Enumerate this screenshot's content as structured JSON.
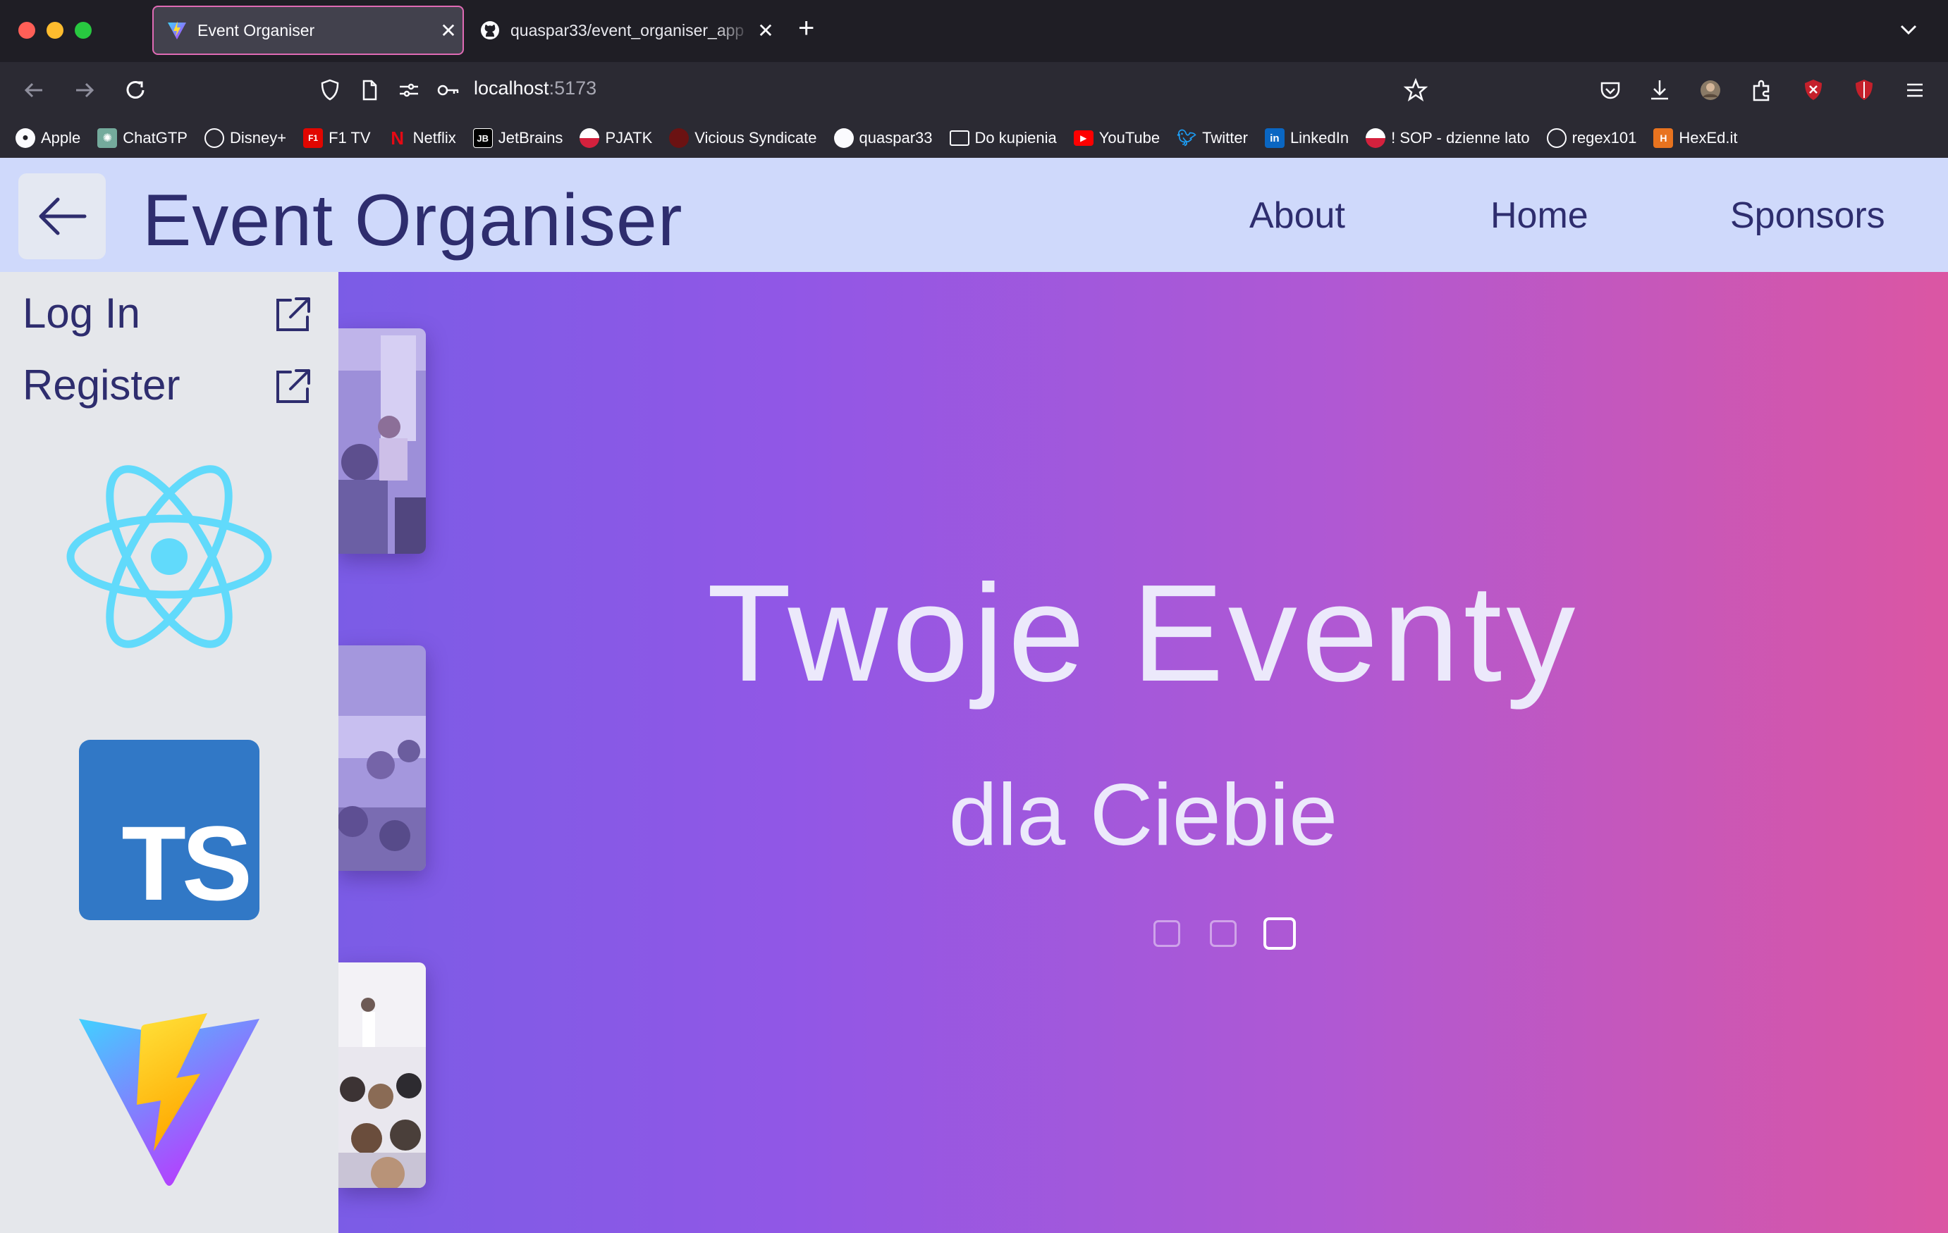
{
  "browser": {
    "tabs": [
      {
        "title": "Event Organiser",
        "active": true
      },
      {
        "title": "quaspar33/event_organiser_app",
        "active": false
      }
    ],
    "url_host": "localhost",
    "url_port": ":5173",
    "bookmarks": [
      {
        "label": "Apple",
        "icon": "apple-icon"
      },
      {
        "label": "ChatGTP",
        "icon": "chatgpt-icon"
      },
      {
        "label": "Disney+",
        "icon": "globe-icon"
      },
      {
        "label": "F1 TV",
        "icon": "f1-icon"
      },
      {
        "label": "Netflix",
        "icon": "netflix-icon"
      },
      {
        "label": "JetBrains",
        "icon": "jetbrains-icon"
      },
      {
        "label": "PJATK",
        "icon": "pjatk-icon"
      },
      {
        "label": "Vicious Syndicate",
        "icon": "vs-icon"
      },
      {
        "label": "quaspar33",
        "icon": "github-icon"
      },
      {
        "label": "Do kupienia",
        "icon": "folder-icon"
      },
      {
        "label": "YouTube",
        "icon": "youtube-icon"
      },
      {
        "label": "Twitter",
        "icon": "twitter-icon"
      },
      {
        "label": "LinkedIn",
        "icon": "linkedin-icon"
      },
      {
        "label": "! SOP - dzienne lato",
        "icon": "sop-icon"
      },
      {
        "label": "regex101",
        "icon": "globe-icon"
      },
      {
        "label": "HexEd.it",
        "icon": "hexed-icon"
      }
    ]
  },
  "header": {
    "title": "Event Organiser",
    "nav": [
      "About",
      "Home",
      "Sponsors"
    ]
  },
  "sidebar": {
    "login": "Log In",
    "register": "Register",
    "logos": [
      "react-logo",
      "typescript-logo",
      "vite-logo"
    ],
    "ts_text": "TS"
  },
  "hero": {
    "title": "Twoje Eventy",
    "subtitle": "dla Ciebie",
    "slides_count": 3,
    "active_slide": 3
  },
  "colors": {
    "header_bg": "#cfd9fb",
    "brand_text": "#2e2d6e",
    "hero_gradient_start": "#7b5ce6",
    "hero_gradient_end": "#db56a3",
    "react_blue": "#61dafb",
    "ts_blue": "#3178c6"
  }
}
